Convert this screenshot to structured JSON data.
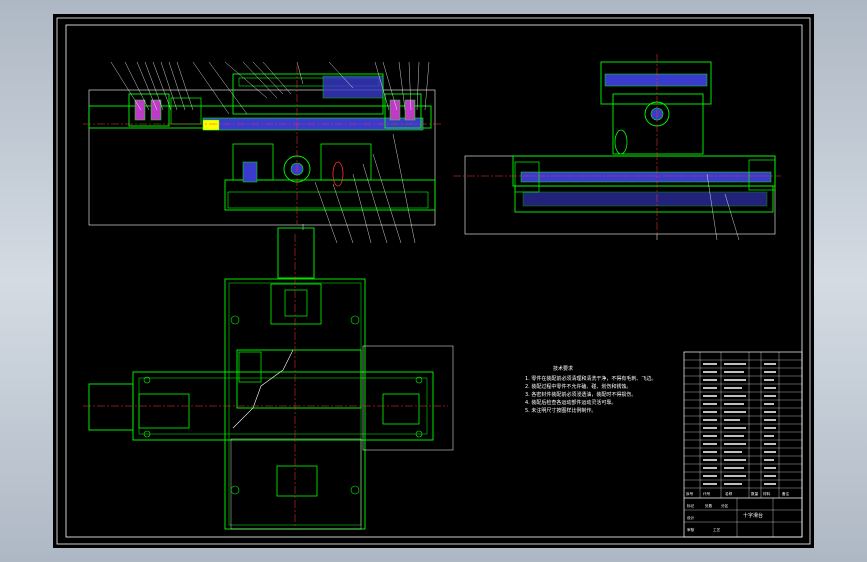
{
  "colors": {
    "background": "#000000",
    "outline": "#00ff00",
    "frame": "#ffffff",
    "section_fill": "#3a3acc",
    "centerline": "#ff3030",
    "hatch": "#c03ac8",
    "leader": "#ffffff",
    "hidden": "#ffff00"
  },
  "drawing": {
    "views": [
      "front-section-view",
      "side-section-view",
      "top-plan-view"
    ],
    "technical_requirements": {
      "title": "技术要求",
      "lines": [
        "1. 零件在装配前必须清理和清洗干净，不得有毛刺、飞边。",
        "2. 装配过程中零件不允许磕、碰、划伤和锈蚀。",
        "3. 各密封件装配前必须浸透油，装配时不得损伤。",
        "4. 装配后检查各运动部件运动灵活可靠。",
        "5. 未注明尺寸按图样比例制作。"
      ]
    },
    "title_block": {
      "header_labels": [
        "序号",
        "代号",
        "名称",
        "数量",
        "材料",
        "备注"
      ],
      "footer_labels": [
        "标记",
        "处数",
        "分区",
        "设计",
        "审核",
        "工艺"
      ],
      "title": "十字滑台"
    }
  }
}
